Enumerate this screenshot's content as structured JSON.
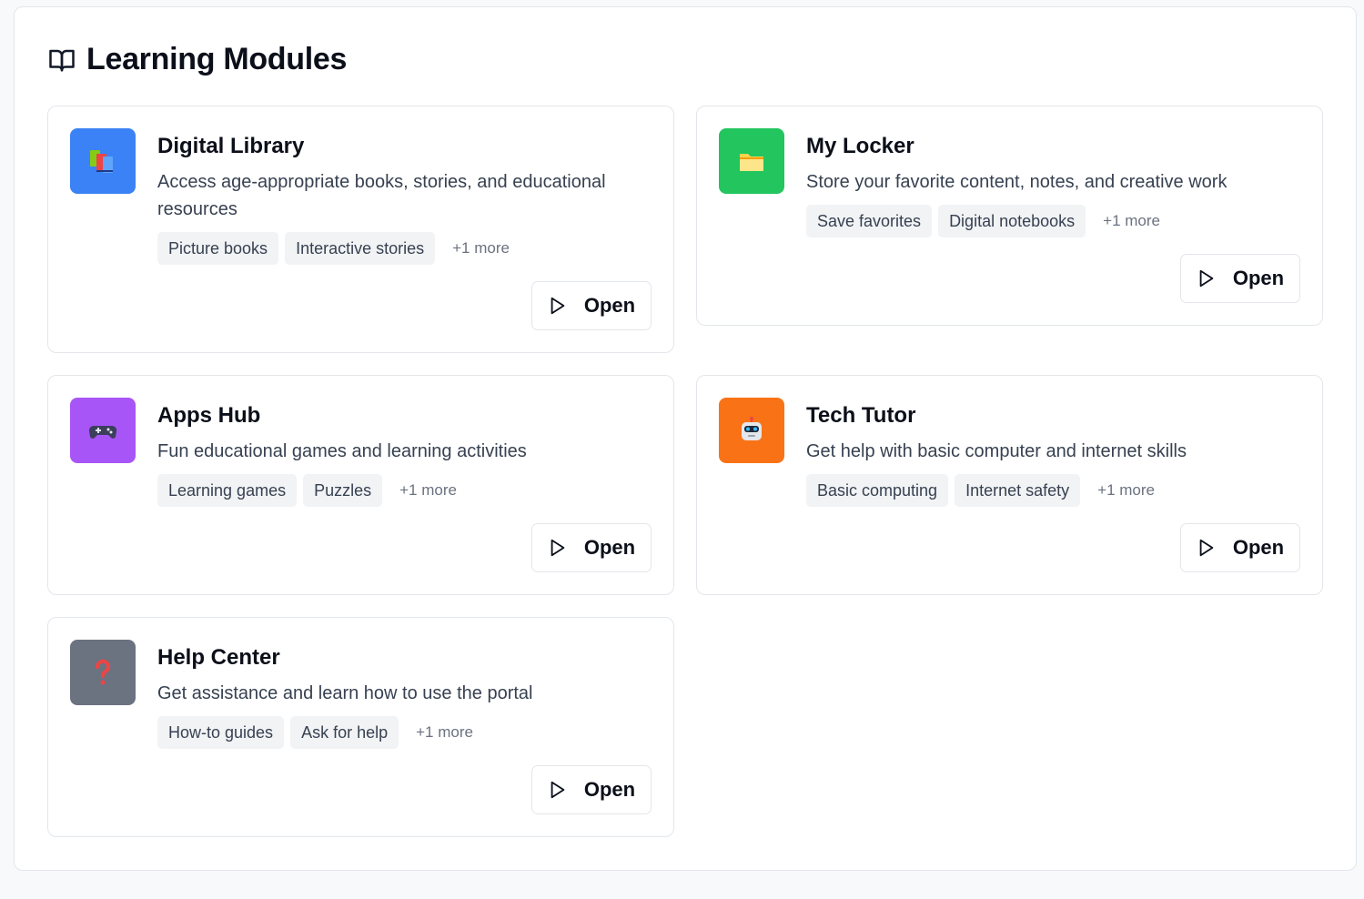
{
  "header": {
    "title": "Learning Modules",
    "icon": "book-open-icon"
  },
  "modules": [
    {
      "title": "Digital Library",
      "description": "Access age-appropriate books, stories, and educational resources",
      "icon": "books-icon",
      "icon_bg": "#3b82f6",
      "tags": [
        "Picture books",
        "Interactive stories"
      ],
      "more": "+1 more",
      "open_label": "Open"
    },
    {
      "title": "My Locker",
      "description": "Store your favorite content, notes, and creative work",
      "icon": "folder-icon",
      "icon_bg": "#22c55e",
      "tags": [
        "Save favorites",
        "Digital notebooks"
      ],
      "more": "+1 more",
      "open_label": "Open"
    },
    {
      "title": "Apps Hub",
      "description": "Fun educational games and learning activities",
      "icon": "game-controller-icon",
      "icon_bg": "#a855f7",
      "tags": [
        "Learning games",
        "Puzzles"
      ],
      "more": "+1 more",
      "open_label": "Open"
    },
    {
      "title": "Tech Tutor",
      "description": "Get help with basic computer and internet skills",
      "icon": "robot-icon",
      "icon_bg": "#f97316",
      "tags": [
        "Basic computing",
        "Internet safety"
      ],
      "more": "+1 more",
      "open_label": "Open"
    },
    {
      "title": "Help Center",
      "description": "Get assistance and learn how to use the portal",
      "icon": "question-mark-icon",
      "icon_bg": "#6b7280",
      "tags": [
        "How-to guides",
        "Ask for help"
      ],
      "more": "+1 more",
      "open_label": "Open"
    }
  ]
}
